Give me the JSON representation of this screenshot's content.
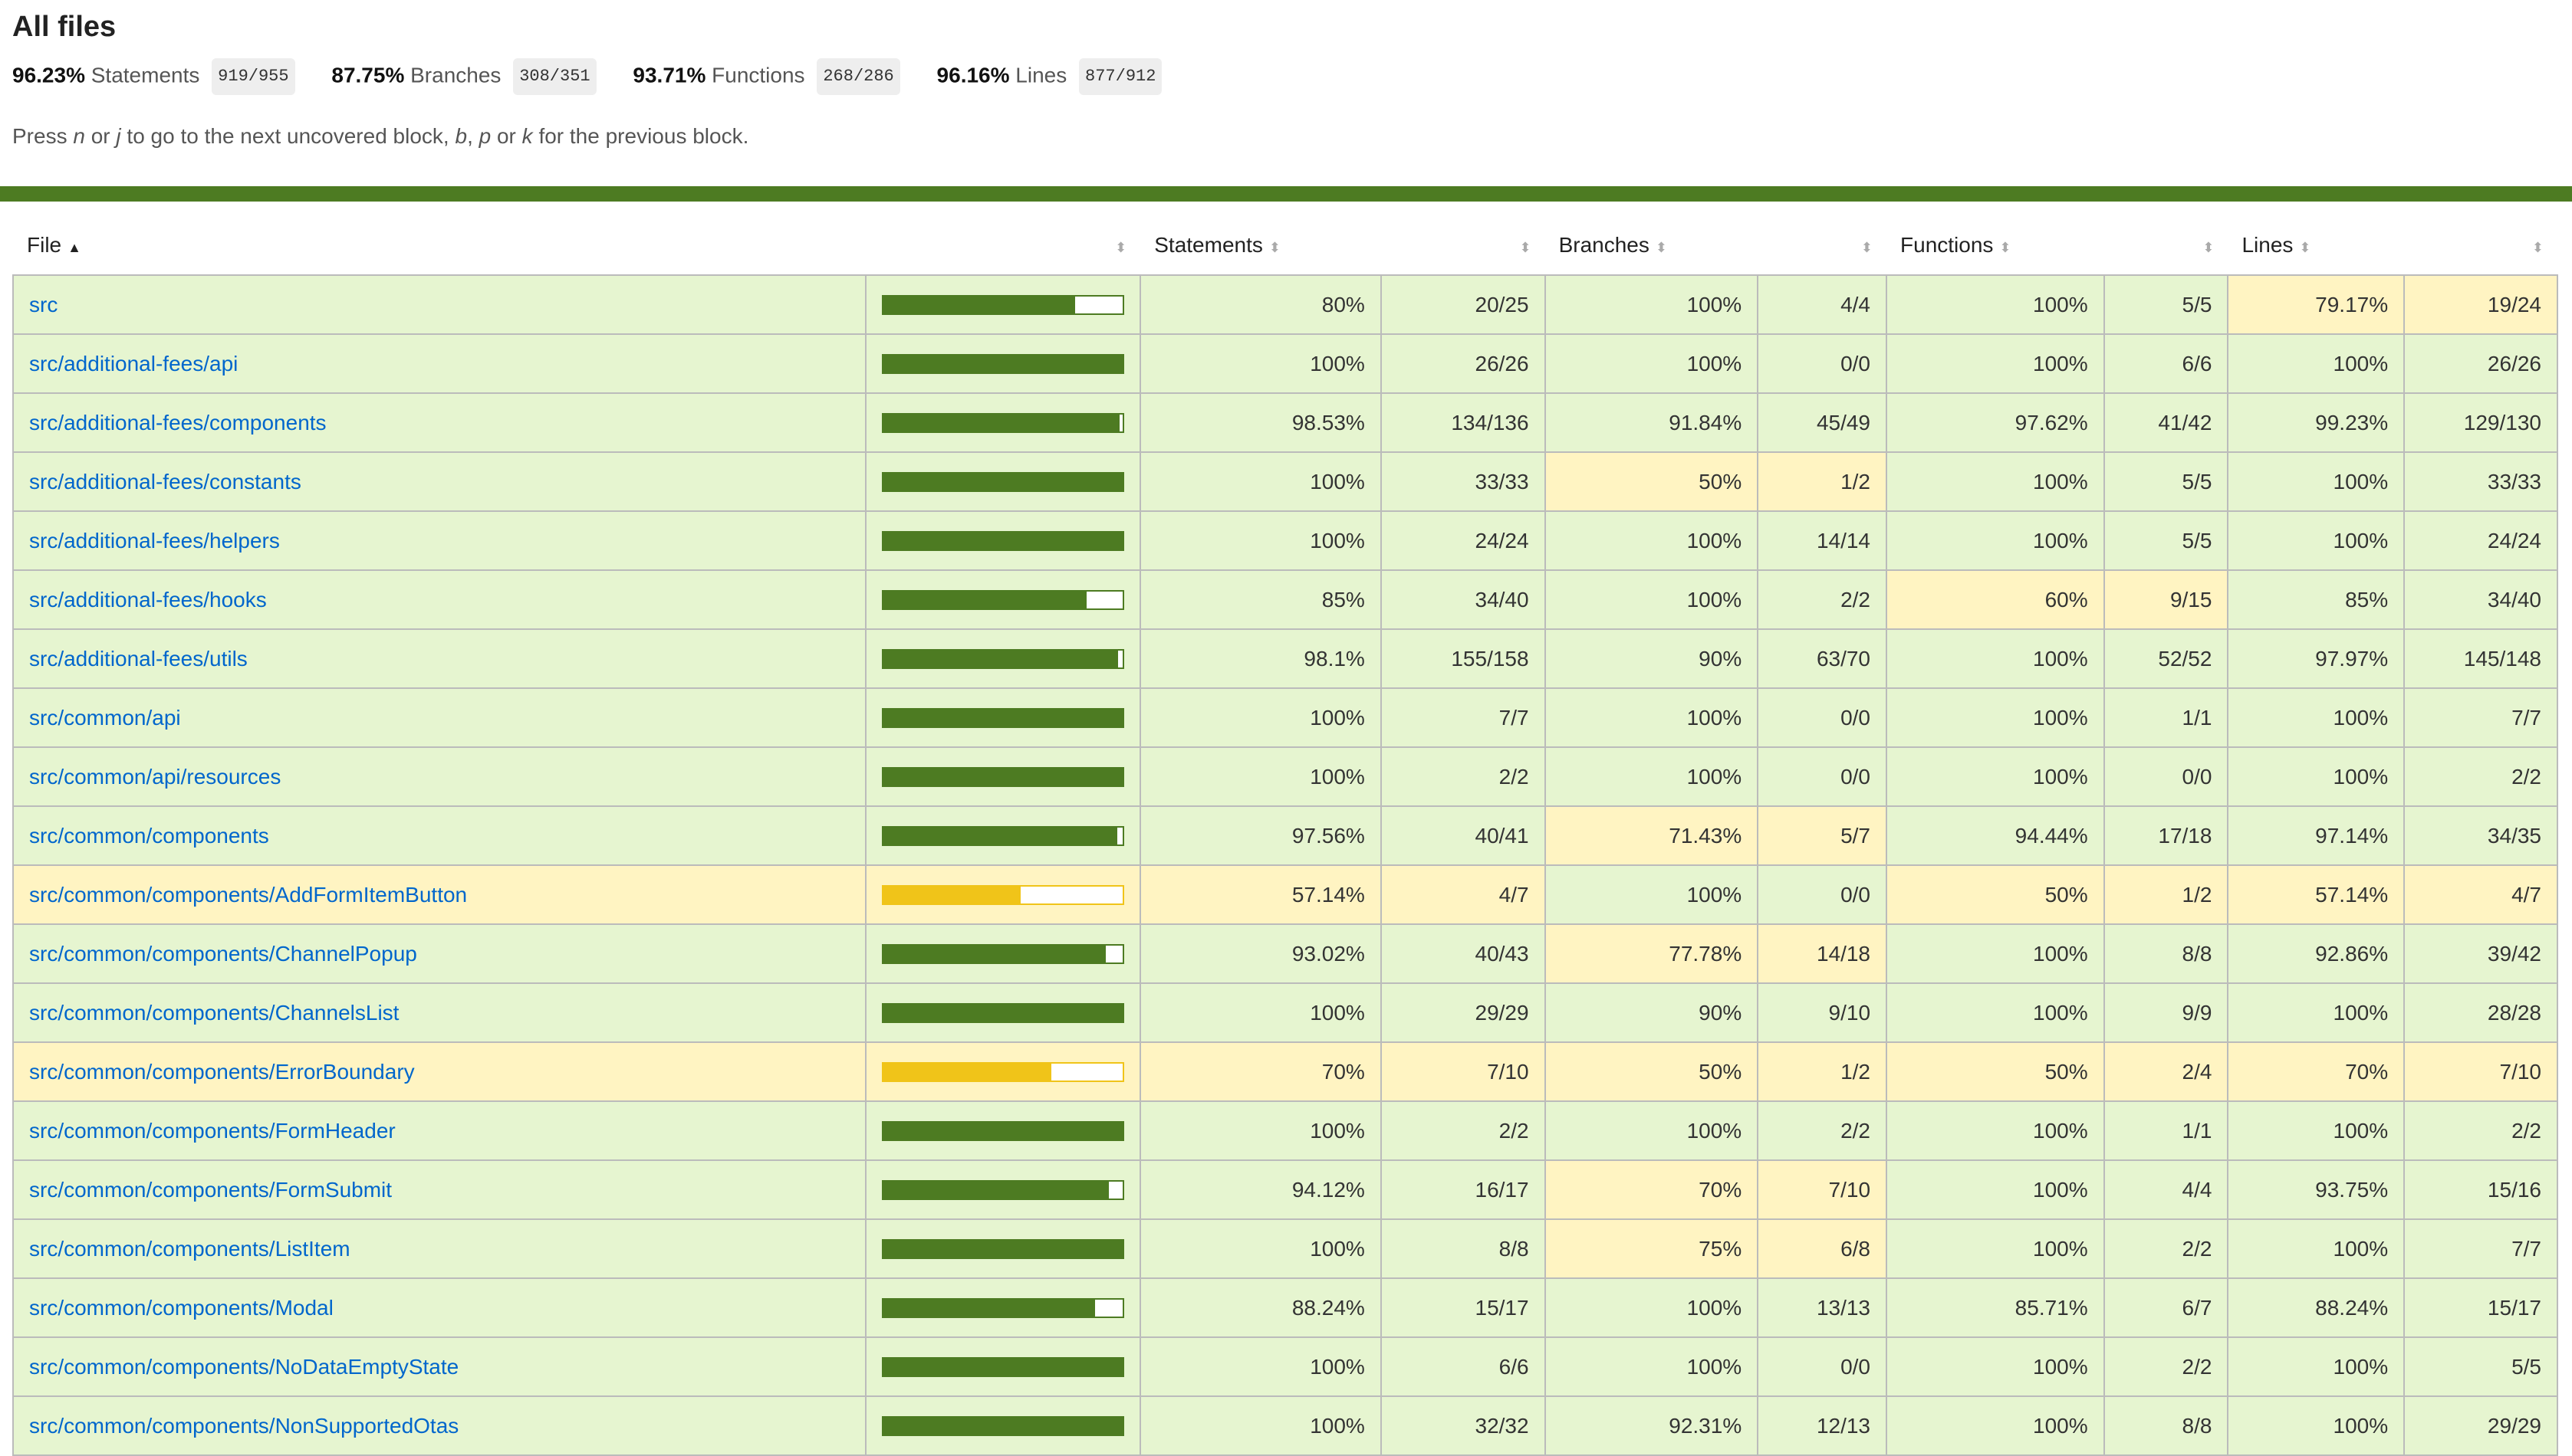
{
  "page": {
    "title": "All files"
  },
  "summary": [
    {
      "pct": "96.23%",
      "label": "Statements",
      "frac": "919/955"
    },
    {
      "pct": "87.75%",
      "label": "Branches",
      "frac": "308/351"
    },
    {
      "pct": "93.71%",
      "label": "Functions",
      "frac": "268/286"
    },
    {
      "pct": "96.16%",
      "label": "Lines",
      "frac": "877/912"
    }
  ],
  "help": {
    "p1": "Press ",
    "k1": "n",
    "p2": " or ",
    "k2": "j",
    "p3": " to go to the next uncovered block, ",
    "k3": "b",
    "p4": ", ",
    "k4": "p",
    "p5": " or ",
    "k5": "k",
    "p6": " for the previous block."
  },
  "table": {
    "headers": {
      "file": "File",
      "statements": "Statements",
      "branches": "Branches",
      "functions": "Functions",
      "lines": "Lines"
    },
    "rows": [
      {
        "file": "src",
        "level": "high",
        "bar": 0.8,
        "s": "80%",
        "sf": "20/25",
        "sl": "high",
        "b": "100%",
        "bf": "4/4",
        "bl": "high",
        "f": "100%",
        "ff": "5/5",
        "fl": "high",
        "l": "79.17%",
        "lf": "19/24",
        "ll": "medium"
      },
      {
        "file": "src/additional-fees/api",
        "level": "high",
        "bar": 1.0,
        "s": "100%",
        "sf": "26/26",
        "sl": "high",
        "b": "100%",
        "bf": "0/0",
        "bl": "high",
        "f": "100%",
        "ff": "6/6",
        "fl": "high",
        "l": "100%",
        "lf": "26/26",
        "ll": "high"
      },
      {
        "file": "src/additional-fees/components",
        "level": "high",
        "bar": 0.9853,
        "s": "98.53%",
        "sf": "134/136",
        "sl": "high",
        "b": "91.84%",
        "bf": "45/49",
        "bl": "high",
        "f": "97.62%",
        "ff": "41/42",
        "fl": "high",
        "l": "99.23%",
        "lf": "129/130",
        "ll": "high"
      },
      {
        "file": "src/additional-fees/constants",
        "level": "high",
        "bar": 1.0,
        "s": "100%",
        "sf": "33/33",
        "sl": "high",
        "b": "50%",
        "bf": "1/2",
        "bl": "medium",
        "f": "100%",
        "ff": "5/5",
        "fl": "high",
        "l": "100%",
        "lf": "33/33",
        "ll": "high"
      },
      {
        "file": "src/additional-fees/helpers",
        "level": "high",
        "bar": 1.0,
        "s": "100%",
        "sf": "24/24",
        "sl": "high",
        "b": "100%",
        "bf": "14/14",
        "bl": "high",
        "f": "100%",
        "ff": "5/5",
        "fl": "high",
        "l": "100%",
        "lf": "24/24",
        "ll": "high"
      },
      {
        "file": "src/additional-fees/hooks",
        "level": "high",
        "bar": 0.85,
        "s": "85%",
        "sf": "34/40",
        "sl": "high",
        "b": "100%",
        "bf": "2/2",
        "bl": "high",
        "f": "60%",
        "ff": "9/15",
        "fl": "medium",
        "l": "85%",
        "lf": "34/40",
        "ll": "high"
      },
      {
        "file": "src/additional-fees/utils",
        "level": "high",
        "bar": 0.981,
        "s": "98.1%",
        "sf": "155/158",
        "sl": "high",
        "b": "90%",
        "bf": "63/70",
        "bl": "high",
        "f": "100%",
        "ff": "52/52",
        "fl": "high",
        "l": "97.97%",
        "lf": "145/148",
        "ll": "high"
      },
      {
        "file": "src/common/api",
        "level": "high",
        "bar": 1.0,
        "s": "100%",
        "sf": "7/7",
        "sl": "high",
        "b": "100%",
        "bf": "0/0",
        "bl": "high",
        "f": "100%",
        "ff": "1/1",
        "fl": "high",
        "l": "100%",
        "lf": "7/7",
        "ll": "high"
      },
      {
        "file": "src/common/api/resources",
        "level": "high",
        "bar": 1.0,
        "s": "100%",
        "sf": "2/2",
        "sl": "high",
        "b": "100%",
        "bf": "0/0",
        "bl": "high",
        "f": "100%",
        "ff": "0/0",
        "fl": "high",
        "l": "100%",
        "lf": "2/2",
        "ll": "high"
      },
      {
        "file": "src/common/components",
        "level": "high",
        "bar": 0.9756,
        "s": "97.56%",
        "sf": "40/41",
        "sl": "high",
        "b": "71.43%",
        "bf": "5/7",
        "bl": "medium",
        "f": "94.44%",
        "ff": "17/18",
        "fl": "high",
        "l": "97.14%",
        "lf": "34/35",
        "ll": "high"
      },
      {
        "file": "src/common/components/AddFormItemButton",
        "level": "medium",
        "bar": 0.5714,
        "s": "57.14%",
        "sf": "4/7",
        "sl": "medium",
        "b": "100%",
        "bf": "0/0",
        "bl": "high",
        "f": "50%",
        "ff": "1/2",
        "fl": "medium",
        "l": "57.14%",
        "lf": "4/7",
        "ll": "medium"
      },
      {
        "file": "src/common/components/ChannelPopup",
        "level": "high",
        "bar": 0.9302,
        "s": "93.02%",
        "sf": "40/43",
        "sl": "high",
        "b": "77.78%",
        "bf": "14/18",
        "bl": "medium",
        "f": "100%",
        "ff": "8/8",
        "fl": "high",
        "l": "92.86%",
        "lf": "39/42",
        "ll": "high"
      },
      {
        "file": "src/common/components/ChannelsList",
        "level": "high",
        "bar": 1.0,
        "s": "100%",
        "sf": "29/29",
        "sl": "high",
        "b": "90%",
        "bf": "9/10",
        "bl": "high",
        "f": "100%",
        "ff": "9/9",
        "fl": "high",
        "l": "100%",
        "lf": "28/28",
        "ll": "high"
      },
      {
        "file": "src/common/components/ErrorBoundary",
        "level": "medium",
        "bar": 0.7,
        "s": "70%",
        "sf": "7/10",
        "sl": "medium",
        "b": "50%",
        "bf": "1/2",
        "bl": "medium",
        "f": "50%",
        "ff": "2/4",
        "fl": "medium",
        "l": "70%",
        "lf": "7/10",
        "ll": "medium"
      },
      {
        "file": "src/common/components/FormHeader",
        "level": "high",
        "bar": 1.0,
        "s": "100%",
        "sf": "2/2",
        "sl": "high",
        "b": "100%",
        "bf": "2/2",
        "bl": "high",
        "f": "100%",
        "ff": "1/1",
        "fl": "high",
        "l": "100%",
        "lf": "2/2",
        "ll": "high"
      },
      {
        "file": "src/common/components/FormSubmit",
        "level": "high",
        "bar": 0.9412,
        "s": "94.12%",
        "sf": "16/17",
        "sl": "high",
        "b": "70%",
        "bf": "7/10",
        "bl": "medium",
        "f": "100%",
        "ff": "4/4",
        "fl": "high",
        "l": "93.75%",
        "lf": "15/16",
        "ll": "high"
      },
      {
        "file": "src/common/components/ListItem",
        "level": "high",
        "bar": 1.0,
        "s": "100%",
        "sf": "8/8",
        "sl": "high",
        "b": "75%",
        "bf": "6/8",
        "bl": "medium",
        "f": "100%",
        "ff": "2/2",
        "fl": "high",
        "l": "100%",
        "lf": "7/7",
        "ll": "high"
      },
      {
        "file": "src/common/components/Modal",
        "level": "high",
        "bar": 0.8824,
        "s": "88.24%",
        "sf": "15/17",
        "sl": "high",
        "b": "100%",
        "bf": "13/13",
        "bl": "high",
        "f": "85.71%",
        "ff": "6/7",
        "fl": "high",
        "l": "88.24%",
        "lf": "15/17",
        "ll": "high"
      },
      {
        "file": "src/common/components/NoDataEmptyState",
        "level": "high",
        "bar": 1.0,
        "s": "100%",
        "sf": "6/6",
        "sl": "high",
        "b": "100%",
        "bf": "0/0",
        "bl": "high",
        "f": "100%",
        "ff": "2/2",
        "fl": "high",
        "l": "100%",
        "lf": "5/5",
        "ll": "high"
      },
      {
        "file": "src/common/components/NonSupportedOtas",
        "level": "high",
        "bar": 1.0,
        "s": "100%",
        "sf": "32/32",
        "sl": "high",
        "b": "92.31%",
        "bf": "12/13",
        "bl": "high",
        "f": "100%",
        "ff": "8/8",
        "fl": "high",
        "l": "100%",
        "lf": "29/29",
        "ll": "high"
      }
    ]
  }
}
